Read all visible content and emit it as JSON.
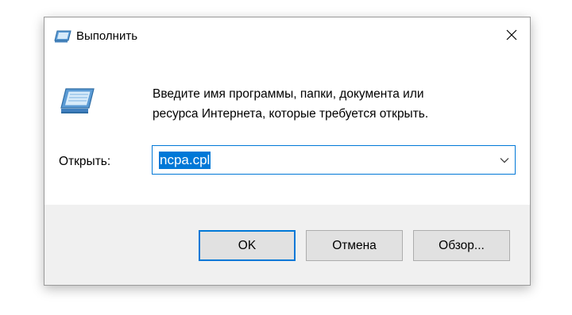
{
  "window": {
    "title": "Выполнить",
    "title_icon": "run-icon",
    "close_icon": "close-icon"
  },
  "body": {
    "icon": "run-icon",
    "description_line1": "Введите имя программы, папки, документа или",
    "description_line2": "ресурса Интернета, которые требуется открыть."
  },
  "open": {
    "label": "Открыть:",
    "value": "ncpa.cpl",
    "dropdown_icon": "chevron-down-icon"
  },
  "buttons": {
    "ok": "OK",
    "cancel": "Отмена",
    "browse": "Обзор..."
  },
  "colors": {
    "accent": "#0078d7",
    "footer_bg": "#f0f0f0",
    "button_bg": "#e1e1e1"
  }
}
